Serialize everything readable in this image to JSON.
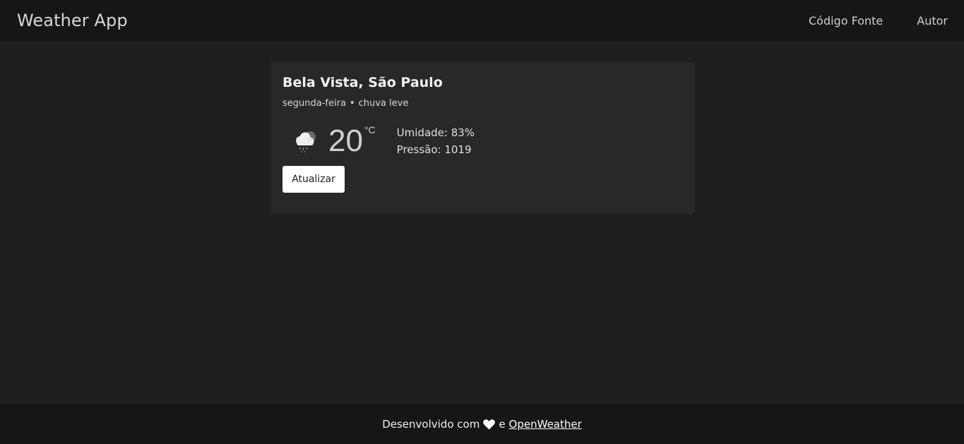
{
  "navbar": {
    "brand": "Weather App",
    "links": [
      {
        "label": "Código Fonte"
      },
      {
        "label": "Autor"
      }
    ]
  },
  "weather": {
    "location": "Bela Vista, São Paulo",
    "day": "segunda-feira",
    "separator": "•",
    "condition": "chuva leve",
    "icon": "cloud-rain-icon",
    "temperature": "20",
    "unit": "°C",
    "humidity": "Umidade: 83%",
    "pressure": "Pressão: 1019",
    "refresh_label": "Atualizar"
  },
  "footer": {
    "text_before": "Desenvolvido com",
    "icon": "heart-icon",
    "text_and": "e",
    "link": "OpenWeather"
  },
  "colors": {
    "background": "#1f1f1f",
    "navbar": "#161616",
    "card": "#282828",
    "button": "#ffffff"
  }
}
